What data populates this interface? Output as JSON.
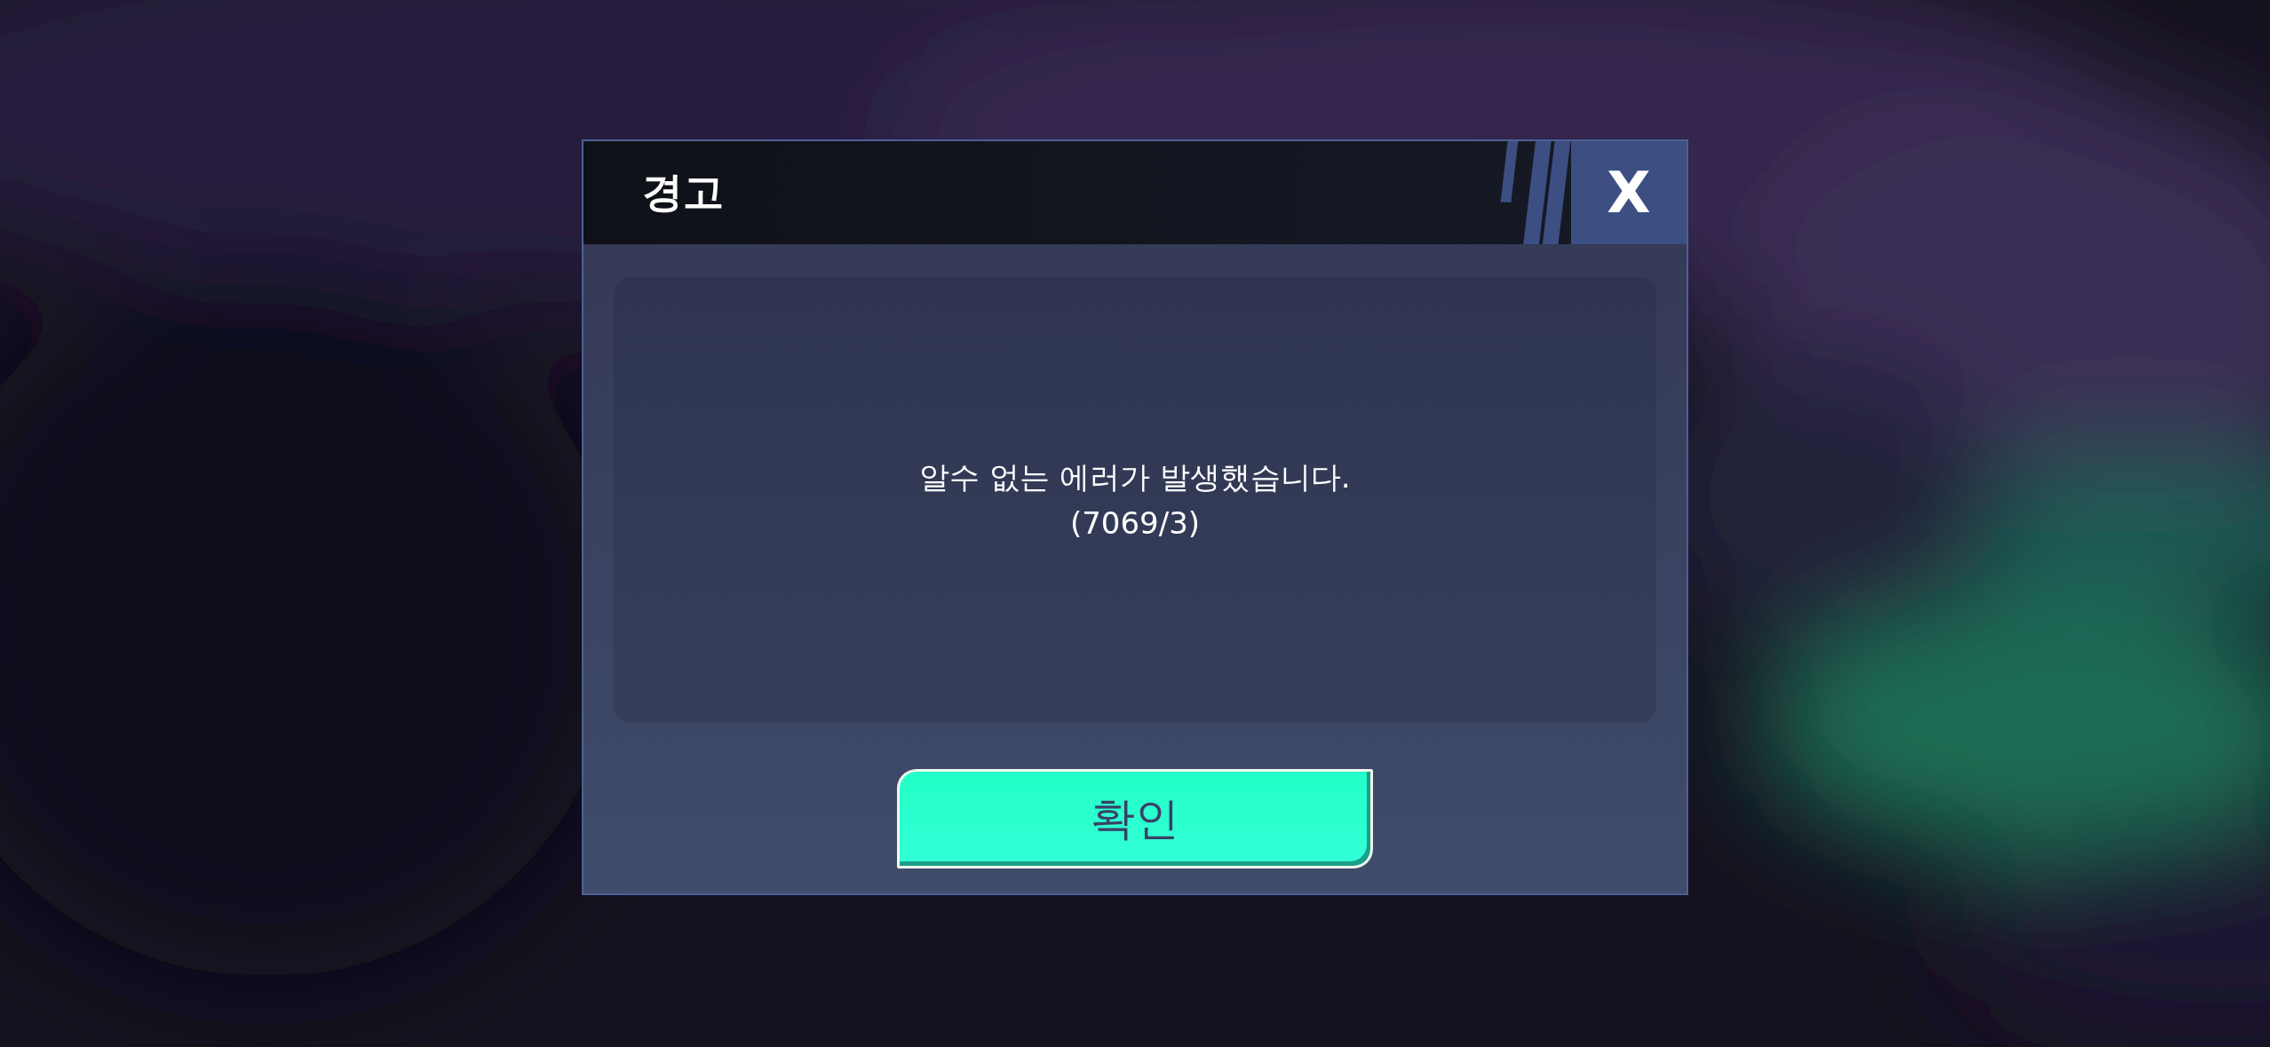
{
  "dialog": {
    "title": "경고",
    "close_label": "X",
    "message_lines": [
      "알수 없는 에러가 발생했습니다.",
      "(7069/3)"
    ],
    "buttons": [
      {
        "label": "확인",
        "kind": "primary"
      }
    ]
  }
}
